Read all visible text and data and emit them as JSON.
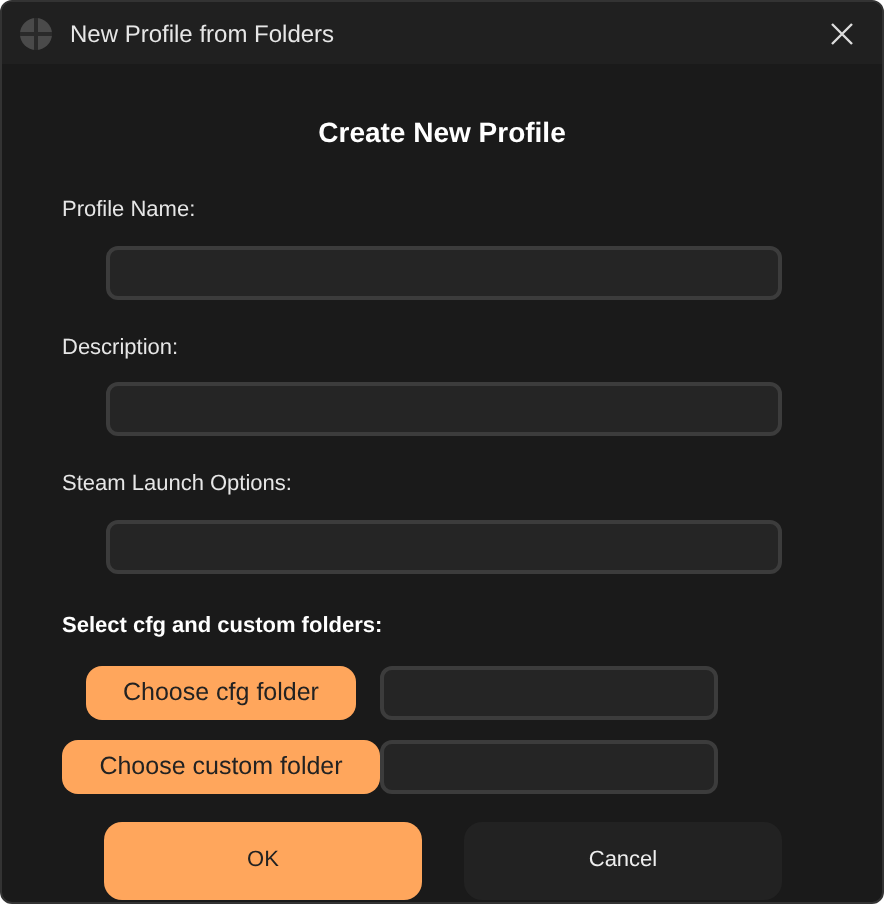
{
  "window": {
    "title": "New Profile from Folders"
  },
  "heading": "Create New Profile",
  "fields": [
    {
      "label": "Profile Name:"
    },
    {
      "label": "Description:"
    },
    {
      "label": "Steam Launch Options:"
    }
  ],
  "folders": {
    "label": "Select cfg and custom folders:",
    "rows": [
      {
        "button": "Choose cfg folder"
      },
      {
        "button": "Choose custom folder"
      }
    ]
  },
  "buttons": [
    {
      "label": "OK",
      "kind": "primary"
    },
    {
      "label": "Cancel",
      "kind": "secondary"
    }
  ]
}
